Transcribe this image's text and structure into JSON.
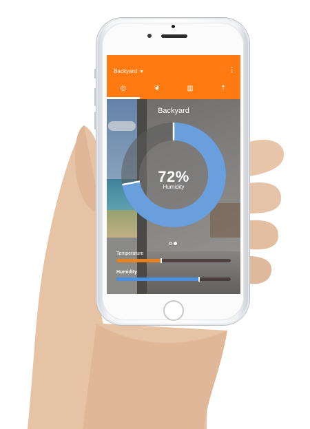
{
  "header": {
    "location": "Backyard",
    "caret": "▼",
    "menu_icon": "more-vertical-icon",
    "tabs": [
      {
        "icon": "gauge-icon",
        "glyph": "◎",
        "active": true
      },
      {
        "icon": "leaf-icon",
        "glyph": "❦",
        "active": false
      },
      {
        "icon": "chart-icon",
        "glyph": "▥",
        "active": false
      },
      {
        "icon": "sprinkler-icon",
        "glyph": "⇡",
        "active": false
      }
    ]
  },
  "main": {
    "title": "Backyard",
    "value": "72%",
    "value_label": "Humidity",
    "humidity_fraction": 0.72
  },
  "metrics": [
    {
      "label": "Temperature",
      "fraction": 0.39,
      "color": "#e8811f"
    },
    {
      "label": "Humidity",
      "fraction": 0.72,
      "color": "#4a90e2"
    }
  ],
  "pager": {
    "pages": 2,
    "current": 2
  },
  "colors": {
    "accent": "#ff7a10",
    "ring": "#6a9fde"
  }
}
